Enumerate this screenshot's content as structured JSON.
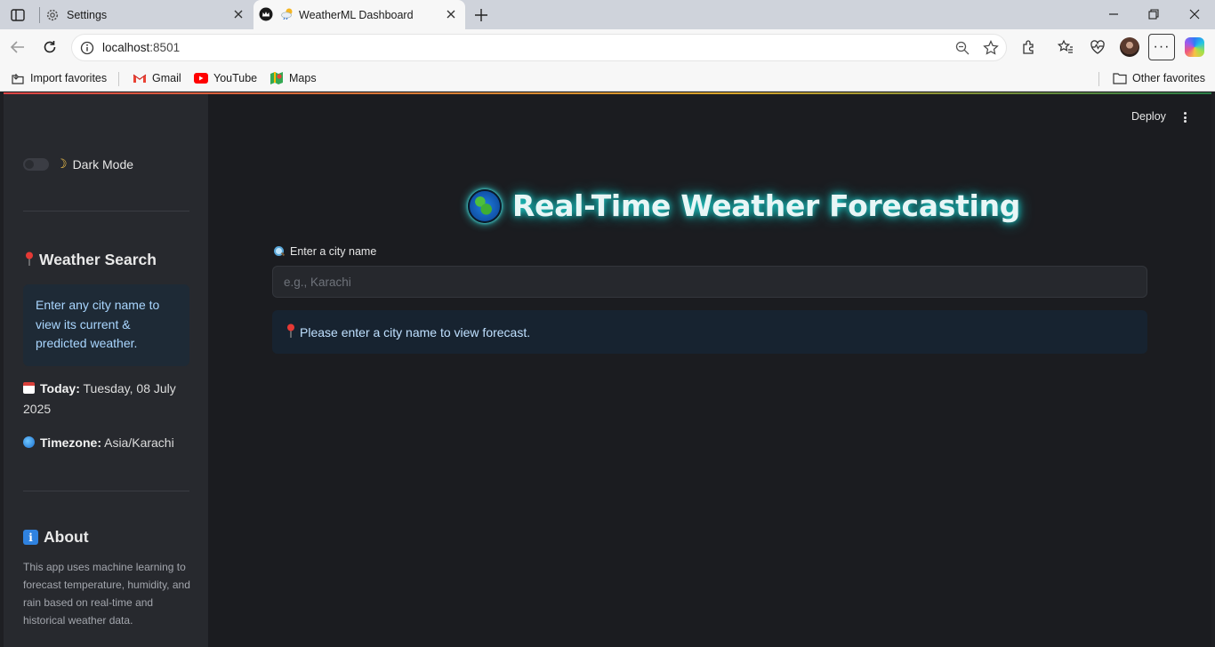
{
  "browser": {
    "tabs": [
      {
        "title": "Settings",
        "icon": "gear-icon"
      },
      {
        "title": "WeatherML Dashboard",
        "icon": "weather-icon"
      }
    ],
    "url_host": "localhost",
    "url_port": ":8501",
    "favorites": [
      {
        "label": "Import favorites",
        "icon": "import-icon"
      },
      {
        "label": "Gmail",
        "icon": "gmail-icon"
      },
      {
        "label": "YouTube",
        "icon": "youtube-icon"
      },
      {
        "label": "Maps",
        "icon": "maps-icon"
      }
    ],
    "other_favorites": "Other favorites"
  },
  "app": {
    "header": {
      "deploy_label": "Deploy"
    },
    "sidebar": {
      "dark_mode_label": "Dark Mode",
      "dark_mode_on": false,
      "search_heading": "Weather Search",
      "search_info": "Enter any city name to view its current & predicted weather.",
      "today_label": "Today:",
      "today_value": "Tuesday, 08 July 2025",
      "timezone_label": "Timezone:",
      "timezone_value": "Asia/Karachi",
      "about_heading": "About",
      "about_text": "This app uses machine learning to forecast temperature, humidity, and rain based on real-time and historical weather data."
    },
    "main": {
      "title": "Real-Time Weather Forecasting",
      "city_label": "Enter a city name",
      "city_placeholder": "e.g., Karachi",
      "city_value": "",
      "prompt_message": "Please enter a city name to view forecast."
    }
  },
  "colors": {
    "sidebar_bg": "#27292e",
    "main_bg": "#1b1c20",
    "title_glow": "#1fd2cf",
    "info_bg": "#1e2a36",
    "info_text": "#a9d6ff"
  }
}
